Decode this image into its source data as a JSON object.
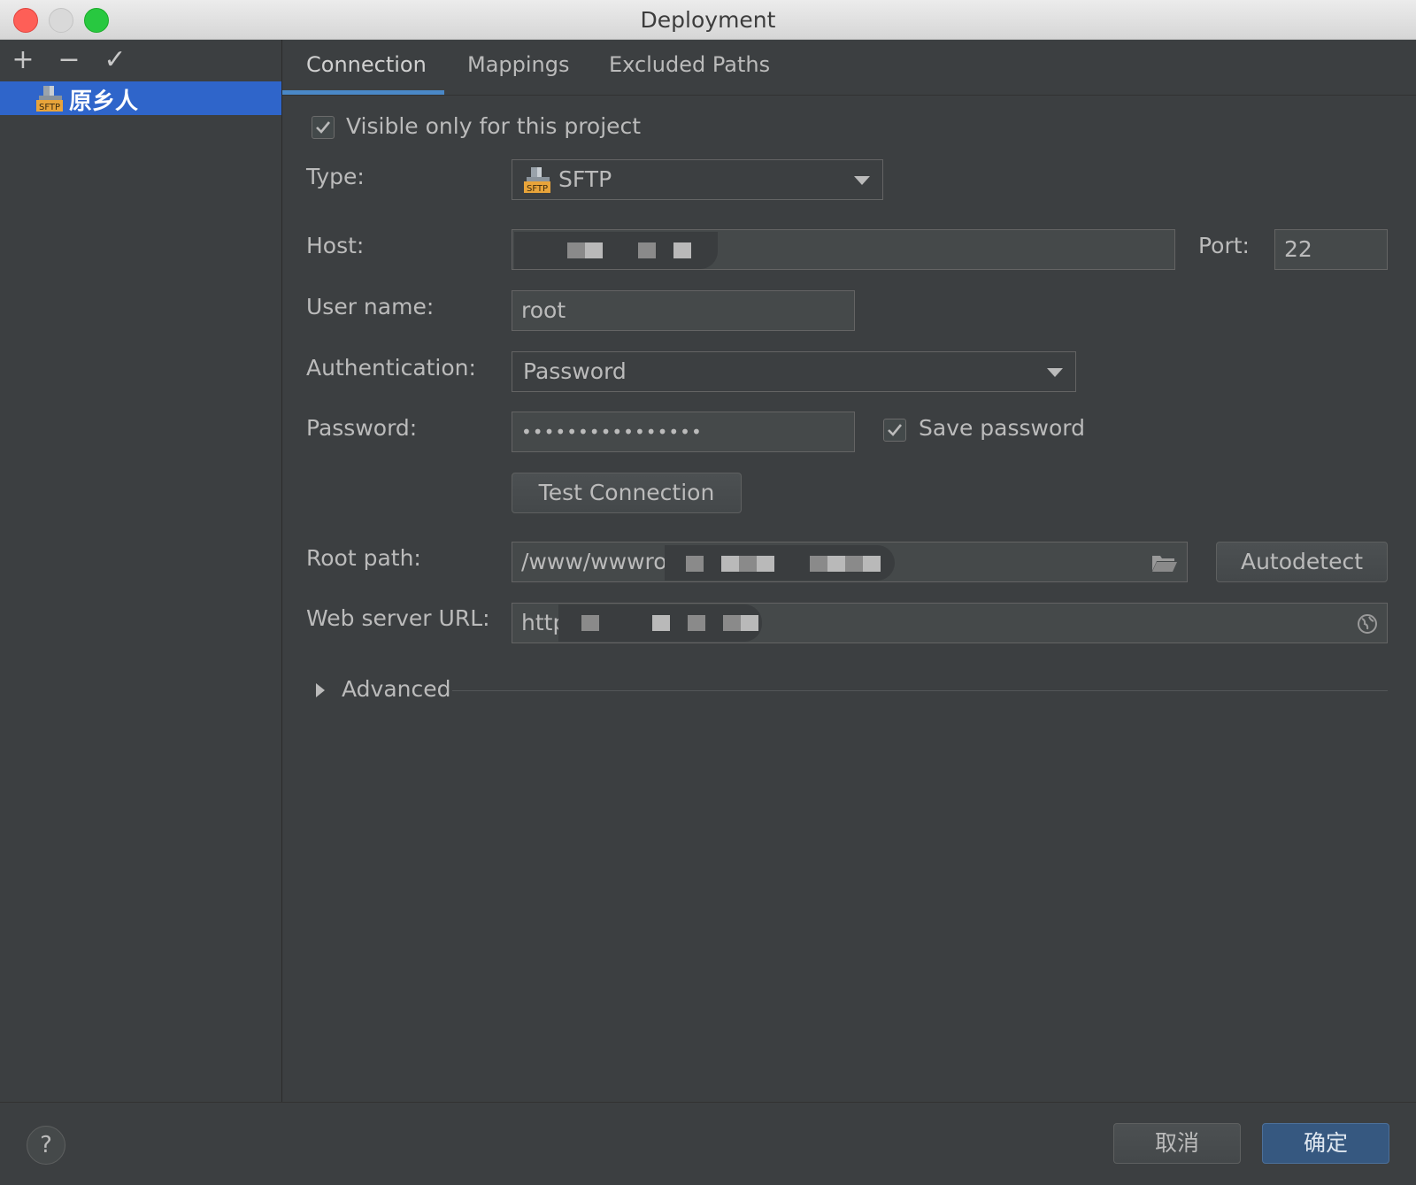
{
  "window": {
    "title": "Deployment"
  },
  "sidebar": {
    "toolbar": {
      "add": "+",
      "remove": "−",
      "apply": "✓"
    },
    "items": [
      {
        "label": "原乡人",
        "icon": "sftp-server-icon"
      }
    ]
  },
  "tabs": [
    {
      "label": "Connection",
      "active": true
    },
    {
      "label": "Mappings",
      "active": false
    },
    {
      "label": "Excluded Paths",
      "active": false
    }
  ],
  "connection": {
    "visible_only": {
      "label": "Visible only for this project",
      "checked": true
    },
    "type": {
      "label": "Type:",
      "value": "SFTP"
    },
    "host": {
      "label": "Host:",
      "value": ""
    },
    "port": {
      "label": "Port:",
      "value": "22"
    },
    "username": {
      "label": "User name:",
      "value": "root"
    },
    "authentication": {
      "label": "Authentication:",
      "value": "Password"
    },
    "password": {
      "label": "Password:",
      "value": "••••••••••••••••"
    },
    "save_password": {
      "label": "Save password",
      "checked": true
    },
    "test_connection": "Test Connection",
    "root_path": {
      "label": "Root path:",
      "value": "/www/wwwro"
    },
    "autodetect": "Autodetect",
    "web_server_url": {
      "label": "Web server URL:",
      "value": "http"
    },
    "advanced": "Advanced"
  },
  "footer": {
    "help": "?",
    "cancel": "取消",
    "ok": "确定"
  },
  "colors": {
    "accent": "#2f65ca",
    "tab_underline": "#4a88c7",
    "ok_button": "#365880"
  }
}
